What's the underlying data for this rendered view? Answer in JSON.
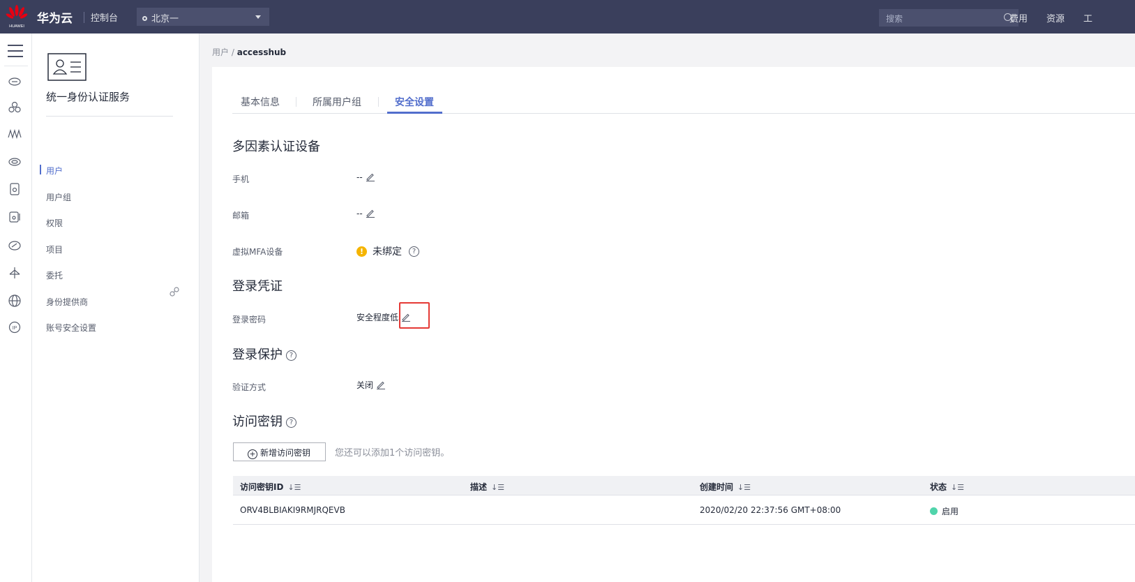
{
  "topbar": {
    "logo_text": "HUAWEI",
    "brand": "华为云",
    "console": "控制台",
    "region": "北京一",
    "search_placeholder": "搜索",
    "links": [
      "费用",
      "资源",
      "工"
    ]
  },
  "sidebar": {
    "service_title": "统一身份认证服务",
    "items": [
      {
        "label": "用户",
        "active": true
      },
      {
        "label": "用户组"
      },
      {
        "label": "权限"
      },
      {
        "label": "项目"
      },
      {
        "label": "委托"
      },
      {
        "label": "身份提供商"
      },
      {
        "label": "账号安全设置"
      }
    ]
  },
  "breadcrumb": {
    "parent": "用户",
    "separator": "/",
    "current": "accesshub"
  },
  "tabs": [
    {
      "label": "基本信息"
    },
    {
      "label": "所属用户组"
    },
    {
      "label": "安全设置",
      "active": true
    }
  ],
  "mfa": {
    "title": "多因素认证设备",
    "phone_label": "手机",
    "phone_value": "--",
    "email_label": "邮箱",
    "email_value": "--",
    "virtual_label": "虚拟MFA设备",
    "virtual_value": "未绑定"
  },
  "credential": {
    "title": "登录凭证",
    "password_label": "登录密码",
    "password_value": "安全程度低"
  },
  "protection": {
    "title": "登录保护",
    "method_label": "验证方式",
    "method_value": "关闭"
  },
  "access_keys": {
    "title": "访问密钥",
    "add_button": "新增访问密钥",
    "hint": "您还可以添加1个访问密钥。",
    "columns": [
      "访问密钥ID",
      "描述",
      "创建时间",
      "状态"
    ],
    "rows": [
      {
        "id": "ORV4BLBIAKI9RMJRQEVB",
        "description": "",
        "created": "2020/02/20 22:37:56 GMT+08:00",
        "status": "启用"
      }
    ]
  },
  "colors": {
    "accent": "#526ecc",
    "topbar": "#3a3f5c",
    "warning": "#f5b400",
    "ok": "#50d4ab",
    "highlight": "#e53935"
  }
}
